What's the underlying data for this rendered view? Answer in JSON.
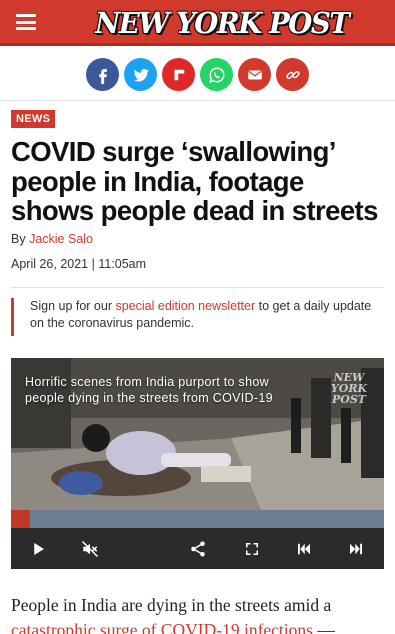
{
  "header": {
    "logo_text": "NEW YORK POST",
    "brand_color": "#d0392b"
  },
  "share_bar": {
    "buttons": [
      {
        "name": "facebook",
        "icon": "facebook-icon",
        "color": "#3b5998"
      },
      {
        "name": "twitter",
        "icon": "twitter-icon",
        "color": "#1da1f2"
      },
      {
        "name": "flipboard",
        "icon": "flipboard-icon",
        "color": "#e12828"
      },
      {
        "name": "whatsapp",
        "icon": "whatsapp-icon",
        "color": "#25d366"
      },
      {
        "name": "email",
        "icon": "email-icon",
        "color": "#d0392b"
      },
      {
        "name": "copy-link",
        "icon": "link-icon",
        "color": "#d0392b"
      }
    ]
  },
  "article": {
    "section_badge": "NEWS",
    "headline": "COVID surge ‘swallowing’ people in India, footage shows people dead in streets",
    "byline_prefix": "By",
    "author": "Jackie Salo",
    "date": "April 26, 2021 | 11:05am",
    "promo_before": "Sign up for our",
    "promo_link": "special edition newsletter",
    "promo_after": "to get a daily update on the coronavirus pandemic.",
    "body_before": "People in India are dying in the streets amid a",
    "body_link": "catastrophic surge of COVID-19 infections",
    "body_after": "—"
  },
  "video": {
    "caption": "Horrific scenes from India purport to show people dying in the streets from COVID-19",
    "watermark": "NEW YORK POST",
    "progress": 0.05,
    "controls": [
      "play-icon",
      "mute-icon",
      "share-icon",
      "fullscreen-icon",
      "skip-back-icon",
      "skip-forward-icon"
    ]
  }
}
